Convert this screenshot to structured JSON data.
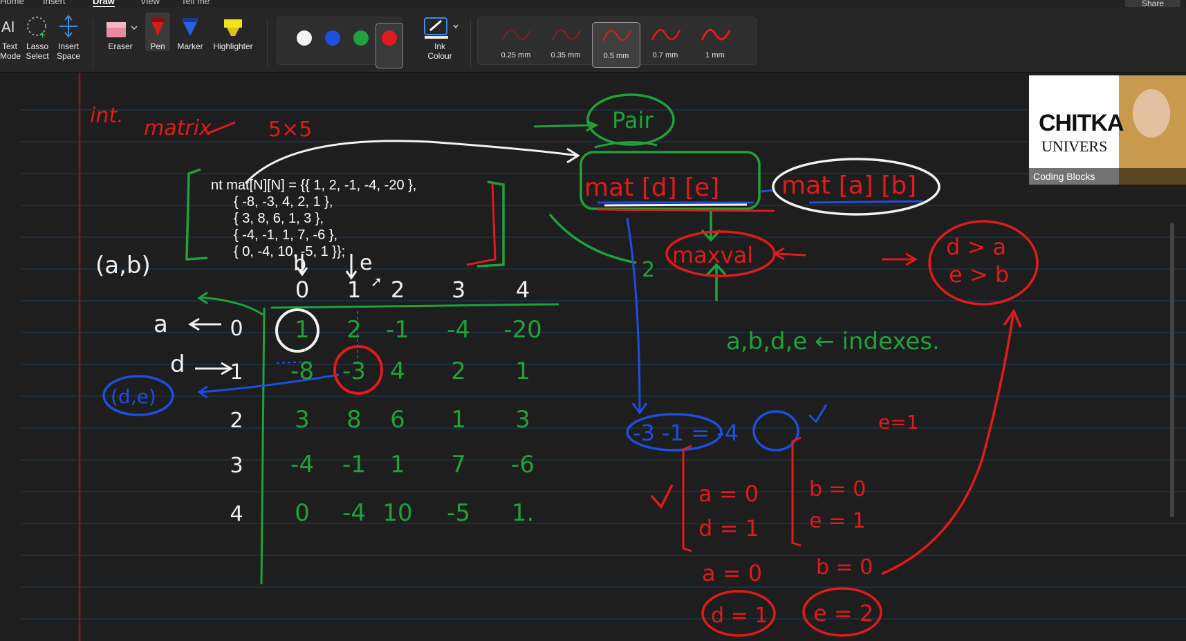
{
  "tabs": [
    "Home",
    "Insert",
    "Draw",
    "View",
    "Tell me"
  ],
  "active_tab": "Draw",
  "share_label": "Share",
  "ribbon": {
    "tools": [
      {
        "name": "text-mode",
        "label": "Text\nMode"
      },
      {
        "name": "lasso-select",
        "label": "Lasso\nSelect"
      },
      {
        "name": "insert-space",
        "label": "Insert\nSpace"
      },
      {
        "name": "eraser",
        "label": "Eraser"
      },
      {
        "name": "pen",
        "label": "Pen"
      },
      {
        "name": "marker",
        "label": "Marker"
      },
      {
        "name": "highlighter",
        "label": "Highlighter"
      }
    ],
    "colors": [
      "#f2f2f2",
      "#1d4fe0",
      "#1fa23a",
      "#e01b1b"
    ],
    "selected_color": "#e01b1b",
    "ink_colour_label": "Ink\nColour",
    "thickness": [
      "0.25 mm",
      "0.35 mm",
      "0.5 mm",
      "0.7 mm",
      "1 mm"
    ],
    "selected_thickness": "0.5 mm"
  },
  "code": {
    "line1": "nt mat[N][N] = {{ 1, 2, -1, -4, -20 },",
    "line2": "{ -8, -3, 4, 2, 1 },",
    "line3": "{ 3, 8, 6, 1, 3 },",
    "line4": "{ -4, -1, 1, 7, -6 },",
    "line5": "{ 0, -4, 10, -5, 1 }};"
  },
  "notes": {
    "int": "int.",
    "matrix": "matrix",
    "size": "5×5",
    "pair": "Pair",
    "mat_de": "mat [d] [e]",
    "mat_ab": "mat [a] [b]",
    "maxval": "maxval",
    "cond1": "d > a",
    "cond2": "e > b",
    "indexes": "a,b,d,e ← indexes.",
    "ab": "(a,b)",
    "de": "(d,e)",
    "a_label": "a",
    "d_label": "d",
    "b_label": "b",
    "e_label": "e",
    "calc": "-3 -1 = -4",
    "e_eq1": "e=1",
    "a0": "a = 0",
    "d1": "d = 1",
    "b0": "b = 0",
    "e1": "e = 1",
    "a0b": "a = 0",
    "b0b": "b = 0",
    "d1b": "d = 1",
    "e2": "e = 2",
    "two": "2"
  },
  "matrix": {
    "col_headers": [
      "0",
      "1",
      "2",
      "3",
      "4"
    ],
    "row_headers": [
      "0",
      "1",
      "2",
      "3",
      "4"
    ],
    "rows": [
      [
        "1",
        "2",
        "-1",
        "-4",
        "-20"
      ],
      [
        "-8",
        "-3",
        "4",
        "2",
        "1"
      ],
      [
        "3",
        "8",
        "6",
        "1",
        "3"
      ],
      [
        "-4",
        "-1",
        "1",
        "7",
        "-6"
      ],
      [
        "0",
        "-4",
        "10",
        "-5",
        "1."
      ]
    ]
  },
  "webcam": {
    "brand1": "CHITKA",
    "brand2": "UNIVERS",
    "caption": "Coding Blocks"
  }
}
